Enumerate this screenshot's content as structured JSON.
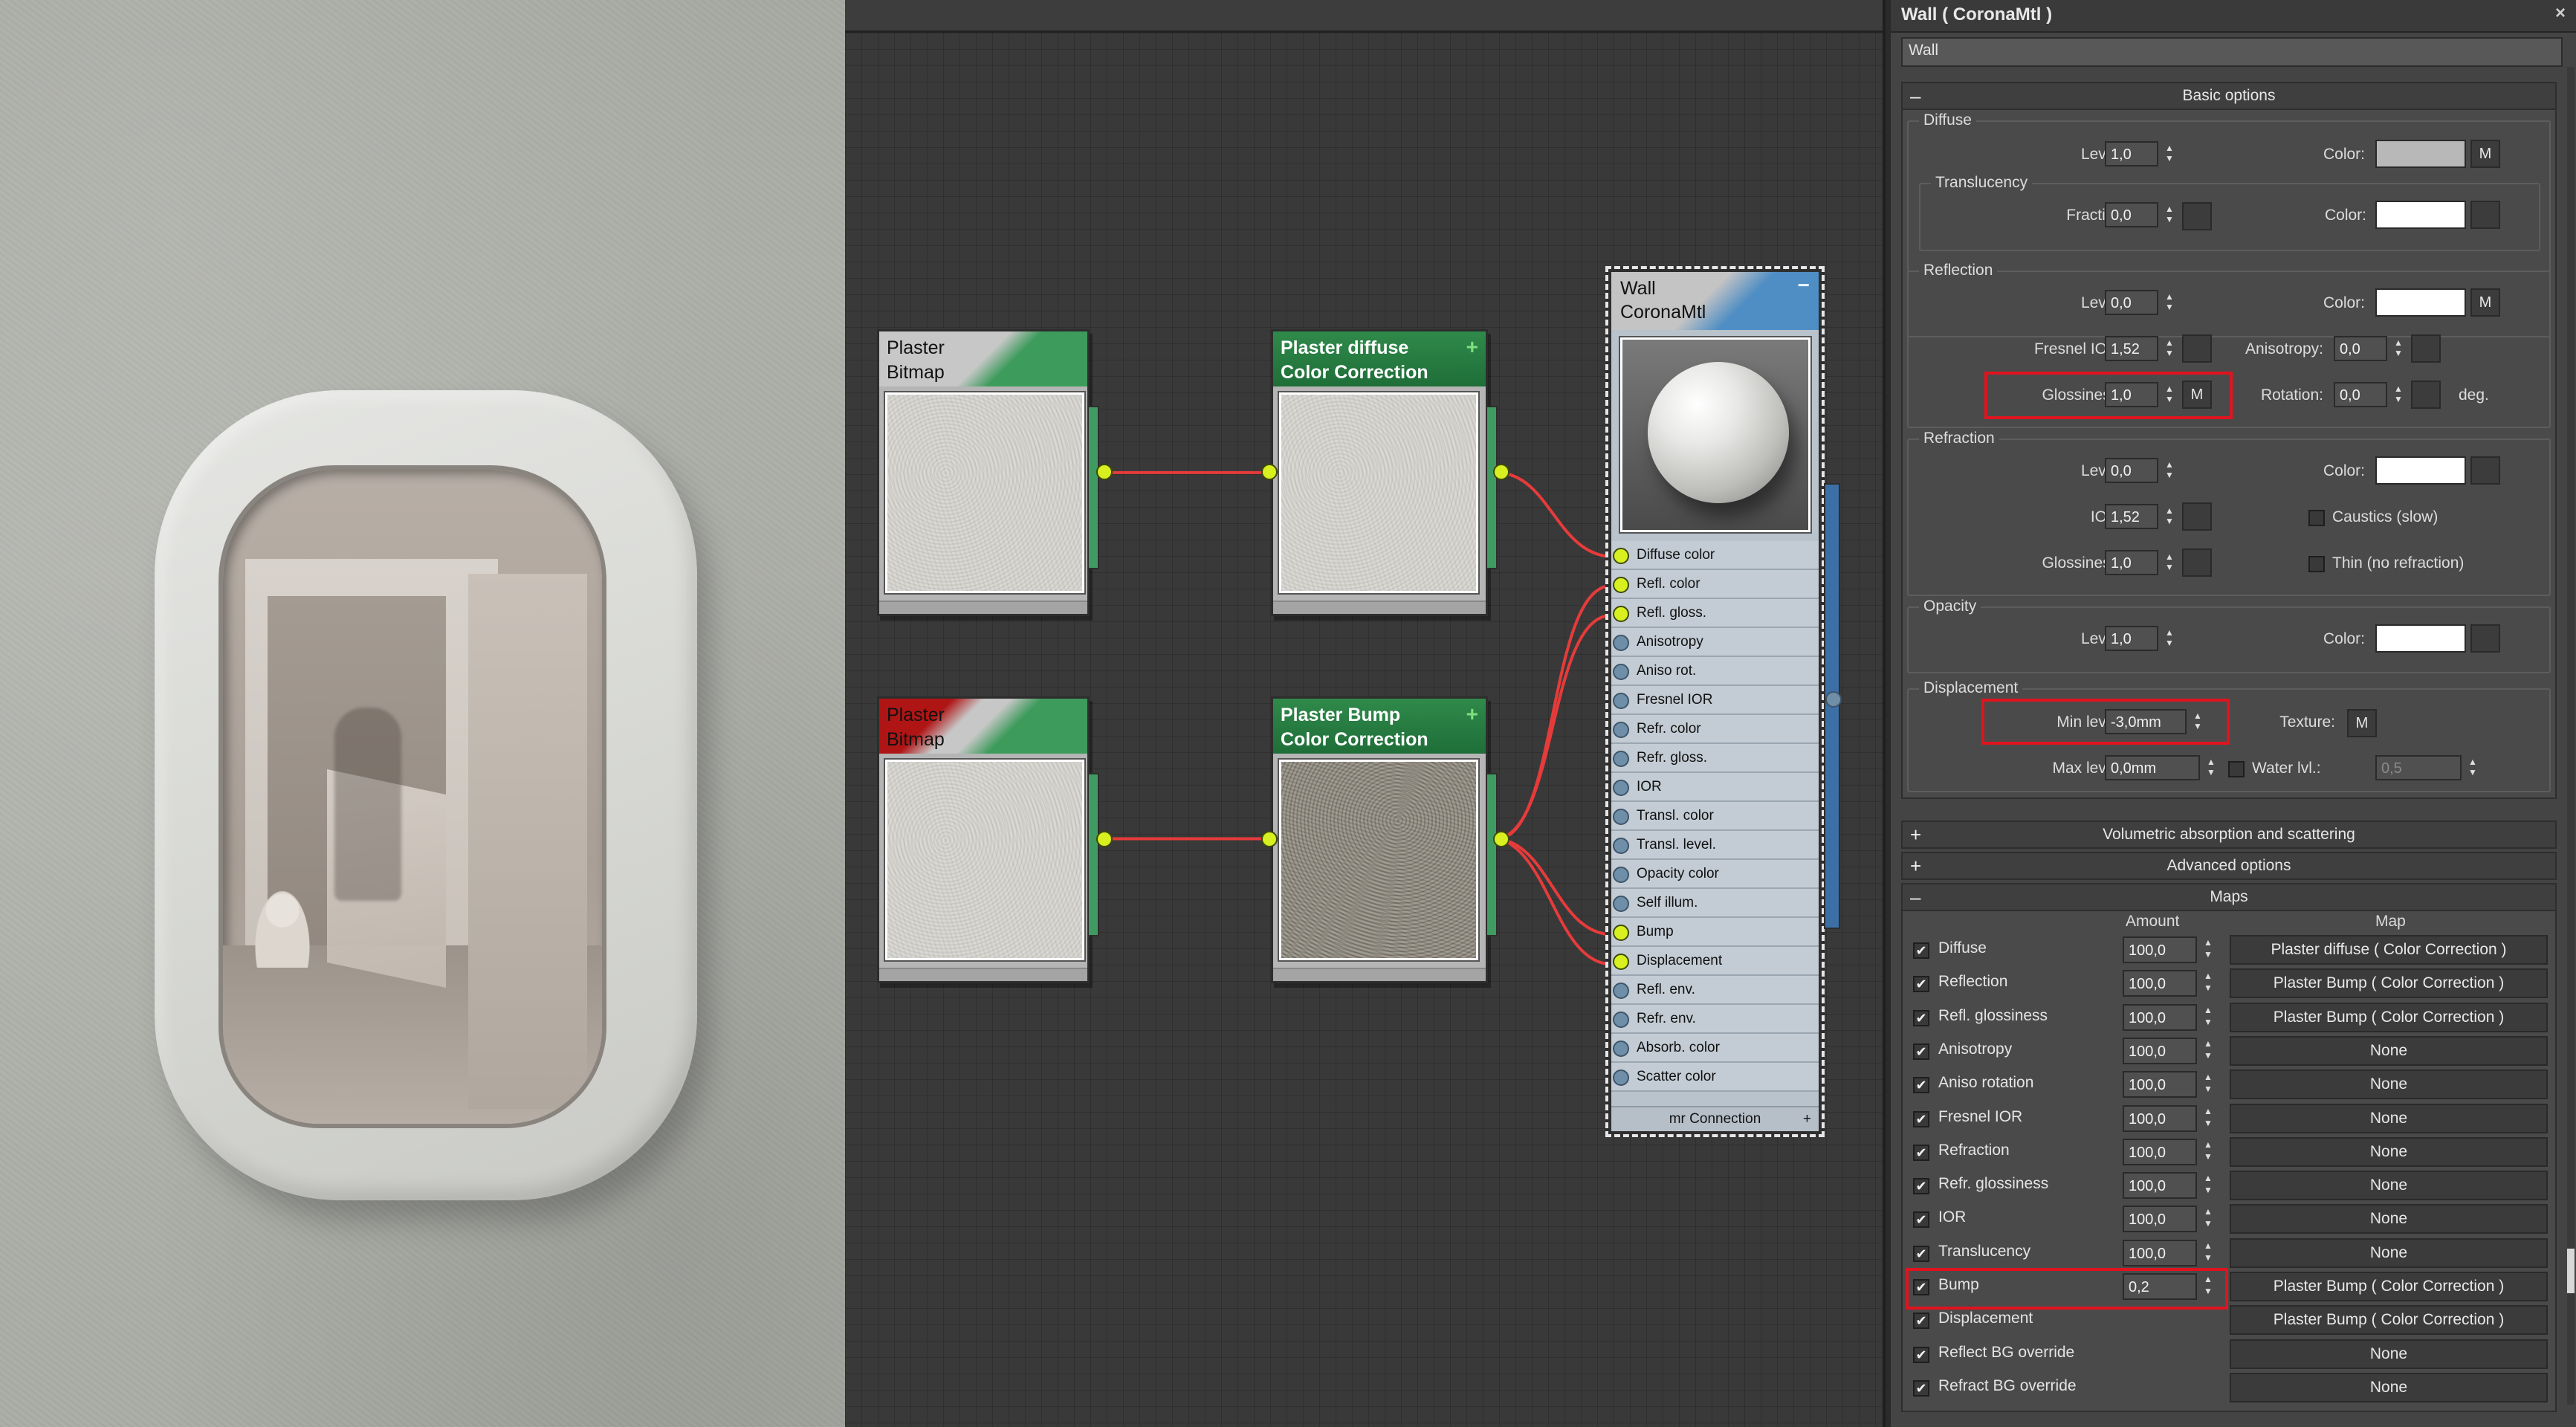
{
  "node_editor": {
    "nodes": {
      "plaster_bitmap_1": {
        "line1": "Plaster",
        "line2": "Bitmap"
      },
      "plaster_diffuse_cc": {
        "line1": "Plaster diffuse",
        "line2": "Color Correction",
        "plus": "+"
      },
      "plaster_bitmap_2": {
        "line1": "Plaster",
        "line2": "Bitmap"
      },
      "plaster_bump_cc": {
        "line1": "Plaster Bump",
        "line2": "Color Correction",
        "plus": "+"
      },
      "wall": {
        "line1": "Wall",
        "line2": "CoronaMtl",
        "minus": "−"
      }
    },
    "wall_slots": [
      "Diffuse color",
      "Refl. color",
      "Refl. gloss.",
      "Anisotropy",
      "Aniso rot.",
      "Fresnel IOR",
      "Refr. color",
      "Refr. gloss.",
      "IOR",
      "Transl. color",
      "Transl. level.",
      "Opacity color",
      "Self illum.",
      "Bump",
      "Displacement",
      "Refl. env.",
      "Refr. env.",
      "Absorb. color",
      "Scatter color"
    ],
    "linked_slots": [
      "Diffuse color",
      "Refl. color",
      "Refl. gloss.",
      "Bump",
      "Displacement"
    ],
    "wall_footer": "mr Connection",
    "wall_footer_plus": "+"
  },
  "panel": {
    "title": "Wall  ( CoronaMtl )",
    "close": "×",
    "material_name": "Wall",
    "basic_options": {
      "header": "Basic options",
      "toggle": "–",
      "diffuse": {
        "label": "Diffuse",
        "level_label": "Level:",
        "level": "1,0",
        "color_label": "Color:",
        "color": "#b8b8b8",
        "m": "M"
      },
      "translucency": {
        "label": "Translucency",
        "fraction_label": "Fraction:",
        "fraction": "0,0",
        "color_label": "Color:",
        "color": "#ffffff"
      },
      "reflection": {
        "label": "Reflection",
        "level_label": "Level:",
        "level": "0,0",
        "color_label": "Color:",
        "color": "#ffffff",
        "m": "M",
        "fresnel_label": "Fresnel IOR:",
        "fresnel": "1,52",
        "anisotropy_label": "Anisotropy:",
        "anisotropy": "0,0",
        "glossiness_label": "Glossiness:",
        "glossiness": "1,0",
        "gloss_m": "M",
        "rotation_label": "Rotation:",
        "rotation": "0,0",
        "deg": "deg."
      },
      "refraction": {
        "label": "Refraction",
        "level_label": "Level:",
        "level": "0,0",
        "color_label": "Color:",
        "color": "#ffffff",
        "ior_label": "IOR:",
        "ior": "1,52",
        "caustics": "Caustics (slow)",
        "glossiness_label": "Glossiness:",
        "glossiness": "1,0",
        "thin": "Thin (no refraction)"
      },
      "opacity": {
        "label": "Opacity",
        "level_label": "Level:",
        "level": "1,0",
        "color_label": "Color:",
        "color": "#ffffff"
      },
      "displacement": {
        "label": "Displacement",
        "min_label": "Min level:",
        "min": "-3,0mm",
        "texture_label": "Texture:",
        "texture_m": "M",
        "max_label": "Max level:",
        "max": "0,0mm",
        "water_label": "Water lvl.:",
        "water": "0,5"
      }
    },
    "volumetric": {
      "header": "Volumetric absorption and scattering",
      "toggle": "+"
    },
    "advanced": {
      "header": "Advanced options",
      "toggle": "+"
    },
    "maps": {
      "header": "Maps",
      "toggle": "–",
      "col_amount": "Amount",
      "col_map": "Map",
      "rows": [
        {
          "name": "Diffuse",
          "amount": "100,0",
          "map": "Plaster diffuse  ( Color Correction )"
        },
        {
          "name": "Reflection",
          "amount": "100,0",
          "map": "Plaster Bump  ( Color Correction )"
        },
        {
          "name": "Refl. glossiness",
          "amount": "100,0",
          "map": "Plaster Bump  ( Color Correction )"
        },
        {
          "name": "Anisotropy",
          "amount": "100,0",
          "map": "None"
        },
        {
          "name": "Aniso rotation",
          "amount": "100,0",
          "map": "None"
        },
        {
          "name": "Fresnel IOR",
          "amount": "100,0",
          "map": "None"
        },
        {
          "name": "Refraction",
          "amount": "100,0",
          "map": "None"
        },
        {
          "name": "Refr. glossiness",
          "amount": "100,0",
          "map": "None"
        },
        {
          "name": "IOR",
          "amount": "100,0",
          "map": "None"
        },
        {
          "name": "Translucency",
          "amount": "100,0",
          "map": "None"
        },
        {
          "name": "Bump",
          "amount": "0,2",
          "map": "Plaster Bump  ( Color Correction )"
        },
        {
          "name": "Displacement",
          "amount": "",
          "map": "Plaster Bump  ( Color Correction )"
        },
        {
          "name": "Reflect BG override",
          "amount": "",
          "map": "None"
        },
        {
          "name": "Refract BG override",
          "amount": "",
          "map": "None"
        }
      ]
    },
    "colors": {
      "highlight": "#e0141e",
      "accent_wire": "#e63b3b",
      "socket": "#d8f020"
    }
  }
}
